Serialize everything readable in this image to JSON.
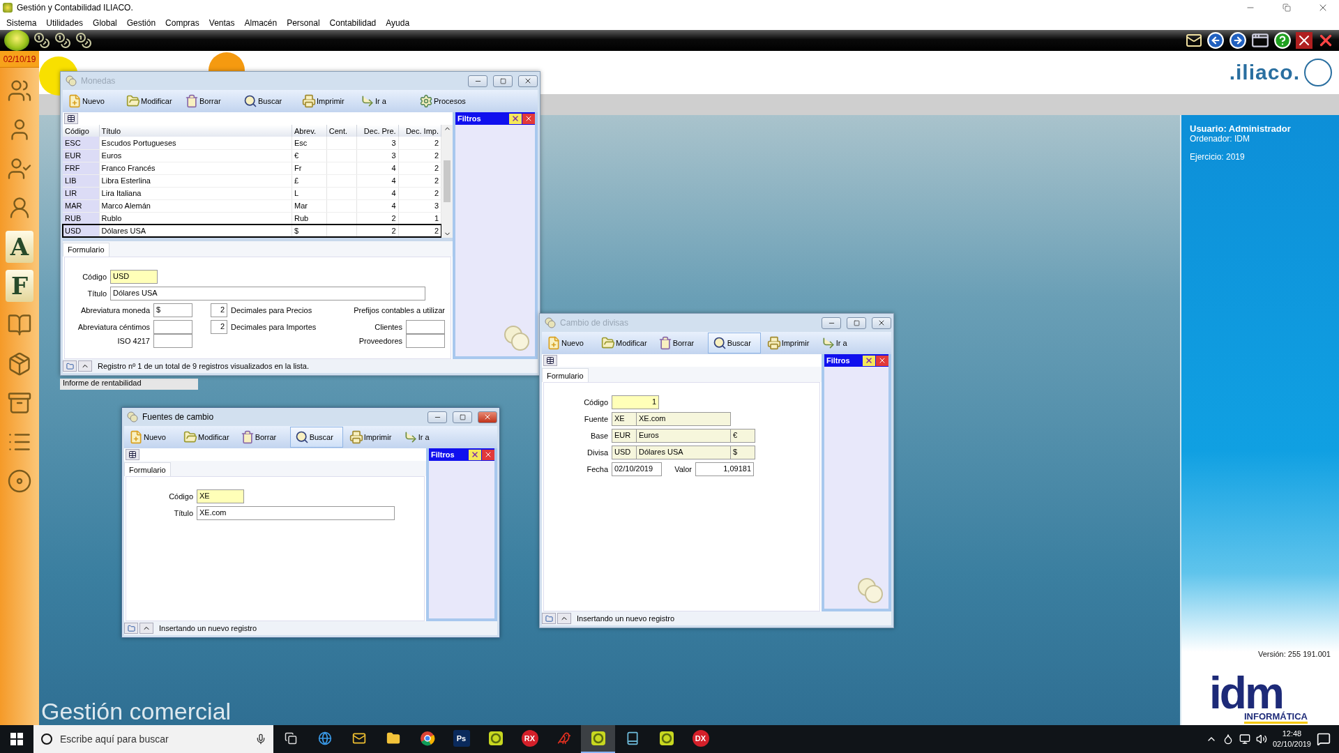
{
  "app_title": "Gestión y Contabilidad ILIACO.",
  "menu": [
    "Sistema",
    "Utilidades",
    "Global",
    "Gestión",
    "Compras",
    "Ventas",
    "Almacén",
    "Personal",
    "Contabilidad",
    "Ayuda"
  ],
  "date_badge": "02/10/19",
  "sidebar": [
    {
      "kind": "users"
    },
    {
      "kind": "user"
    },
    {
      "kind": "user-check"
    },
    {
      "kind": "user-round"
    },
    {
      "kind": "letter",
      "text": "A"
    },
    {
      "kind": "letter",
      "text": "F"
    },
    {
      "kind": "book"
    },
    {
      "kind": "package"
    },
    {
      "kind": "drawer"
    },
    {
      "kind": "list"
    },
    {
      "kind": "disc"
    }
  ],
  "brand": ".iliaco.",
  "info_panel": {
    "user": "Usuario: Administrador",
    "computer": "Ordenador: IDM",
    "year": "Ejercicio: 2019",
    "version": "Versión: 255 191.001",
    "logo": "idm",
    "logo_sub": "INFORMÁTICA"
  },
  "background_item": "Informe de rentabilidad",
  "module_title": "Gestión comercial",
  "windows": [
    {
      "kind": "currencies",
      "title": "Monedas",
      "active": false,
      "toolbar": [
        {
          "kind": "new",
          "label": "Nuevo",
          "selected": false
        },
        {
          "kind": "edit",
          "label": "Modificar",
          "selected": false
        },
        {
          "kind": "delete",
          "label": "Borrar",
          "selected": false
        },
        {
          "kind": "search",
          "label": "Buscar",
          "selected": false
        },
        {
          "kind": "print",
          "label": "Imprimir",
          "selected": false
        },
        {
          "kind": "goto",
          "label": "Ir a",
          "selected": false
        },
        {
          "kind": "process",
          "label": "Procesos",
          "selected": false
        }
      ],
      "filters": "Filtros",
      "tab": "Formulario",
      "table": {
        "columns": [
          "Código",
          "Título",
          "Abrev.",
          "Cent.",
          "Dec. Pre.",
          "Dec. Imp."
        ],
        "rows": [
          {
            "code": "ESC",
            "title": "Escudos Portugueses",
            "abbr": "Esc",
            "price_dec": "3",
            "amount_dec": "2",
            "selected": false
          },
          {
            "code": "EUR",
            "title": "Euros",
            "abbr": "€",
            "price_dec": "3",
            "amount_dec": "2",
            "selected": false
          },
          {
            "code": "FRF",
            "title": "Franco Francés",
            "abbr": "Fr",
            "price_dec": "4",
            "amount_dec": "2",
            "selected": false
          },
          {
            "code": "LIB",
            "title": "Libra Esterlina",
            "abbr": "£",
            "price_dec": "4",
            "amount_dec": "2",
            "selected": false
          },
          {
            "code": "LIR",
            "title": "Lira Italiana",
            "abbr": "L",
            "price_dec": "4",
            "amount_dec": "2",
            "selected": false
          },
          {
            "code": "MAR",
            "title": "Marco Alemán",
            "abbr": "Mar",
            "price_dec": "4",
            "amount_dec": "3",
            "selected": false
          },
          {
            "code": "RUB",
            "title": "Rublo",
            "abbr": "Rub",
            "price_dec": "2",
            "amount_dec": "1",
            "selected": false
          },
          {
            "code": "USD",
            "title": "Dólares USA",
            "abbr": "$",
            "price_dec": "2",
            "amount_dec": "2",
            "selected": true
          }
        ]
      },
      "form": {
        "code_label": "Código",
        "code": "USD",
        "title_label": "Título",
        "title": "Dólares USA",
        "abbr_label": "Abreviatura moneda",
        "abbr": "$",
        "cents_label": "Abreviatura céntimos",
        "iso_label": "ISO 4217",
        "price_decimals": "2",
        "price_decimals_label": "Decimales para Precios",
        "amount_decimals": "2",
        "amount_decimals_label": "Decimales para Importes",
        "prefixes_label": "Prefijos contables a utilizar",
        "clients_label": "Clientes",
        "suppliers_label": "Proveedores"
      },
      "status": "Registro nº 1 de un total de 9 registros visualizados en la lista."
    },
    {
      "kind": "sources",
      "title": "Fuentes de cambio",
      "active": true,
      "toolbar": [
        {
          "kind": "new",
          "label": "Nuevo",
          "selected": false
        },
        {
          "kind": "edit",
          "label": "Modificar",
          "selected": false
        },
        {
          "kind": "delete",
          "label": "Borrar",
          "selected": false
        },
        {
          "kind": "search",
          "label": "Buscar",
          "selected": true
        },
        {
          "kind": "print",
          "label": "Imprimir",
          "selected": false
        },
        {
          "kind": "goto",
          "label": "Ir a",
          "selected": false
        }
      ],
      "filters": "Filtros",
      "tab": "Formulario",
      "form": {
        "code_label": "Código",
        "code": "XE",
        "title_label": "Título",
        "title": "XE.com"
      },
      "status": "Insertando un nuevo registro"
    },
    {
      "kind": "rates",
      "title": "Cambio de divisas",
      "active": false,
      "toolbar": [
        {
          "kind": "new",
          "label": "Nuevo",
          "selected": false
        },
        {
          "kind": "edit",
          "label": "Modificar",
          "selected": false
        },
        {
          "kind": "delete",
          "label": "Borrar",
          "selected": false
        },
        {
          "kind": "search",
          "label": "Buscar",
          "selected": true
        },
        {
          "kind": "print",
          "label": "Imprimir",
          "selected": false
        },
        {
          "kind": "goto",
          "label": "Ir a",
          "selected": false
        }
      ],
      "filters": "Filtros",
      "tab": "Formulario",
      "form": {
        "code_label": "Código",
        "code": "1",
        "source_label": "Fuente",
        "source_code": "XE",
        "source_name": "XE.com",
        "base_label": "Base",
        "base_code": "EUR",
        "base_name": "Euros",
        "base_symbol": "€",
        "currency_label": "Divisa",
        "currency_code": "USD",
        "currency_name": "Dólares USA",
        "currency_symbol": "$",
        "date_label": "Fecha",
        "date": "02/10/2019",
        "value_label": "Valor",
        "value": "1,09181"
      },
      "status": "Insertando un nuevo registro"
    }
  ],
  "taskbar": {
    "search_placeholder": "Escribe aquí para buscar",
    "apps": [
      {
        "kind": "taskview",
        "selected": false
      },
      {
        "kind": "edge",
        "selected": false
      },
      {
        "kind": "mail",
        "selected": false
      },
      {
        "kind": "folder",
        "selected": false
      },
      {
        "kind": "chrome",
        "selected": false
      },
      {
        "kind": "badge",
        "text": "Ps",
        "color": "#0a2a5c",
        "selected": false
      },
      {
        "kind": "app",
        "selected": false
      },
      {
        "kind": "badge",
        "text": "RX",
        "color": "#d4202a",
        "selected": false
      },
      {
        "kind": "bird",
        "selected": false
      },
      {
        "kind": "app",
        "selected": true
      },
      {
        "kind": "book",
        "selected": false
      },
      {
        "kind": "app",
        "selected": false
      },
      {
        "kind": "badge",
        "text": "DX",
        "color": "#d4202a",
        "selected": false
      }
    ],
    "time": "12:48",
    "date": "02/10/2019"
  }
}
